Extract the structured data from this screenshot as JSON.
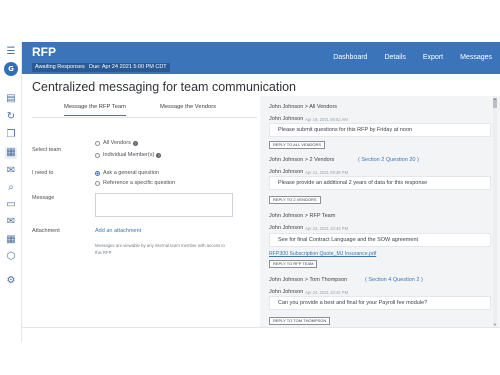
{
  "app": {
    "title": "RFP",
    "status_badge": "Awaiting Responses",
    "due_badge": "Due: Apr 24 2021 5:00 PM CDT"
  },
  "nav": [
    "Dashboard",
    "Details",
    "Export",
    "Messages"
  ],
  "rail": {
    "logo_text": "G",
    "icons": [
      "menu-icon",
      "logo-icon",
      "document-icon",
      "refresh-icon",
      "copy-icon",
      "calendar-icon",
      "chat-icon",
      "search-icon",
      "inbox-icon",
      "mail-icon",
      "grid-icon",
      "tag-icon",
      "settings-icon"
    ]
  },
  "page_title": "Centralized messaging for team communication",
  "tabs": {
    "team": "Message the RFP Team",
    "vendors": "Message the Vendors"
  },
  "form": {
    "select_team_label": "Select team",
    "all_vendors": "All Vendors",
    "individual_members": "Individual Member(s)",
    "need_to_label": "I need to",
    "ask_question": "Ask a general question",
    "reference_question": "Reference a specific question",
    "message_label": "Message",
    "attachment_label": "Attachment",
    "add_attachment": "Add an attachment",
    "note_line1": "Messages are viewable by any internal team member with access to",
    "note_line2": "this RFP"
  },
  "messages": [
    {
      "header": "John Johnson > All Vendors",
      "ref": "",
      "from": "John Johnson",
      "date": "Apr 19, 2021 08:52 AM",
      "text": "Please submit questions for this RFP by Friday at noon",
      "reply": "REPLY TO ALL VENDORS",
      "attachment": ""
    },
    {
      "header": "John Johnson > 2 Vendors",
      "ref": "( Section 2 Question 20 )",
      "from": "John Johnson",
      "date": "Apr 21, 2021 09:38 PM",
      "text": "Please provide an additional 2 years of data for this response",
      "reply": "REPLY TO 2 VENDORS",
      "attachment": ""
    },
    {
      "header": "John Johnson > RFP Team",
      "ref": "",
      "from": "John Johnson",
      "date": "Apr 23, 2021 10:43 PM",
      "text": "See for final Contract Language and the SOW agreement",
      "reply": "REPLY TO RFP TEAM",
      "attachment": "RFP300 Subscription Quote_MJ Insurance.pdf"
    },
    {
      "header": "John Johnson > Tom Thompson",
      "ref": "( Section 4 Question 2 )",
      "from": "John Johnson",
      "date": "Apr 24, 2021 10:42 PM",
      "text": "Can you provide a best and final for your Payroll fee module?",
      "reply": "REPLY TO TOM THOMPSON",
      "attachment": ""
    }
  ],
  "colors": {
    "accent": "#3b74b9",
    "header": "#3b74b9",
    "panel": "#f3f4f6"
  }
}
